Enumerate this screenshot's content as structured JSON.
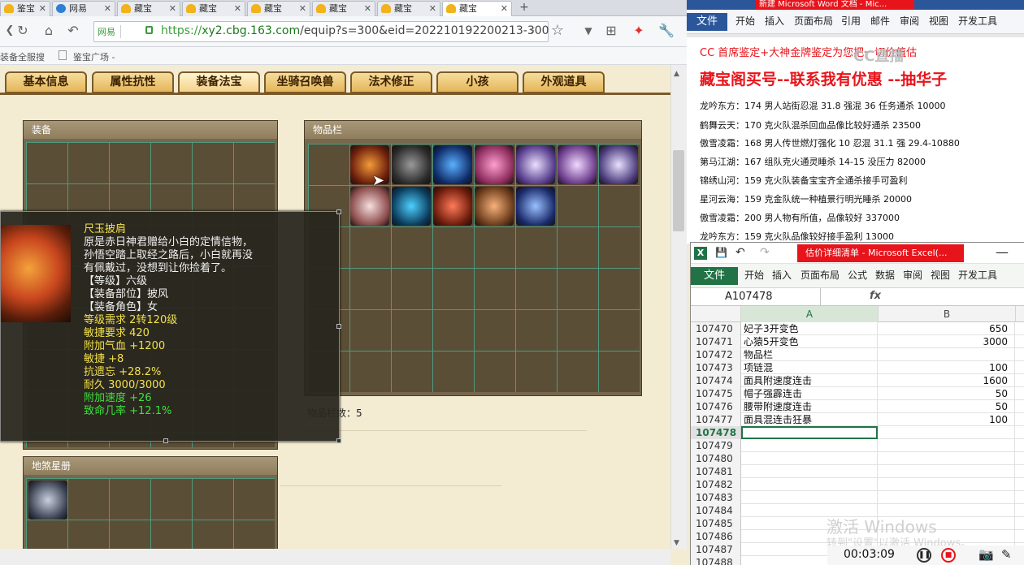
{
  "browser": {
    "tabs": [
      {
        "label": "鉴宝"
      },
      {
        "label": "网易"
      },
      {
        "label": "藏宝"
      },
      {
        "label": "藏宝"
      },
      {
        "label": "藏宝"
      },
      {
        "label": "藏宝"
      },
      {
        "label": "藏宝"
      },
      {
        "label": "藏宝"
      }
    ],
    "new_tab": "+",
    "security_label": "网易",
    "url_scheme": "https://",
    "url_host": "xy2.cbg.163.com",
    "url_path": "/equip?s=300&eid=202210192200213-300",
    "bookmarks": [
      "装备全服搜",
      "鉴宝广场 -"
    ]
  },
  "game": {
    "tabs": [
      "基本信息",
      "属性抗性",
      "装备法宝",
      "坐骑召唤兽",
      "法术修正",
      "小孩",
      "外观道具"
    ],
    "equip_panel_title": "装备",
    "inventory_panel_title": "物品栏",
    "star_panel_title": "地煞星册",
    "item_count_label": "物品栏数：5",
    "tooltip": {
      "name": "尺玉披肩",
      "desc": [
        "原是赤日神君赠给小白的定情信物，",
        "孙悟空踏上取经之路后，小白就再没",
        "有佩戴过，没想到让你捡着了。"
      ],
      "attrs": [
        "【等级】六级",
        "【装备部位】披风",
        "【装备角色】女"
      ],
      "stats": [
        "等级需求  2转120级",
        "敏捷要求  420",
        "附加气血  +1200",
        "敏捷  +8",
        "抗遗忘  +28.2%",
        "耐久  3000/3000"
      ],
      "green_stats": [
        "附加速度  +26",
        "致命几率  +12.1%"
      ]
    }
  },
  "word": {
    "title": "新建 Microsoft Word 文档 - Mic...",
    "file": "文件",
    "ribbon": [
      "开始",
      "插入",
      "页面布局",
      "引用",
      "邮件",
      "审阅",
      "视图",
      "开发工具"
    ],
    "line_cc": "CC 首席鉴定+大神金牌鉴定为您把一切价值估",
    "headline": "藏宝阁买号--联系我有优惠 --抽华子",
    "watermark": "CC直播",
    "lines": [
      "龙吟东方：174 男人站街忍混 31.8 强混 36 任务通杀 10000",
      "鹤舞云天：170 克火队混杀回血品像比较好通杀 23500",
      "傲雪凌霜：168 男人传世燃灯强化 10 忍混 31.1 强 29.4-10880",
      "第马江湖：167 组队克火通灵睡杀 14-15 没压力 82000",
      "锦绣山河：159 克火队装备宝宝齐全通杀接手可盈利",
      "星河云海：159 克金队统一种植景行明光睡杀 20000",
      "傲雪凌霜：200 男人物有所值，品像较好 337000",
      "龙吟东方：159 克火队品像较好接手盈利 13000"
    ]
  },
  "excel": {
    "title": "估价详细清单 - Microsoft Excel(...",
    "file": "文件",
    "ribbon": [
      "开始",
      "插入",
      "页面布局",
      "公式",
      "数据",
      "审阅",
      "视图",
      "开发工具"
    ],
    "name_box": "A107478",
    "fx": "fx",
    "columns": [
      "A",
      "B"
    ],
    "rows": [
      {
        "n": "107470",
        "a": "妃子3开变色",
        "b": "650"
      },
      {
        "n": "107471",
        "a": "心猿5开变色",
        "b": "3000"
      },
      {
        "n": "107472",
        "a": "物品栏",
        "b": ""
      },
      {
        "n": "107473",
        "a": "项链混",
        "b": "100"
      },
      {
        "n": "107474",
        "a": "面具附速度连击",
        "b": "1600"
      },
      {
        "n": "107475",
        "a": "帽子强霹连击",
        "b": "50"
      },
      {
        "n": "107476",
        "a": "腰带附速度连击",
        "b": "50"
      },
      {
        "n": "107477",
        "a": "面具混连击狂暴",
        "b": "100"
      },
      {
        "n": "107478",
        "a": "",
        "b": ""
      },
      {
        "n": "107479",
        "a": "",
        "b": ""
      },
      {
        "n": "107480",
        "a": "",
        "b": ""
      },
      {
        "n": "107481",
        "a": "",
        "b": ""
      },
      {
        "n": "107482",
        "a": "",
        "b": ""
      },
      {
        "n": "107483",
        "a": "",
        "b": ""
      },
      {
        "n": "107484",
        "a": "",
        "b": ""
      },
      {
        "n": "107485",
        "a": "",
        "b": ""
      },
      {
        "n": "107486",
        "a": "",
        "b": ""
      },
      {
        "n": "107487",
        "a": "",
        "b": ""
      },
      {
        "n": "107488",
        "a": "",
        "b": ""
      }
    ]
  },
  "overlay": {
    "activate_windows": "激活 Windows",
    "activate_hint": "转到\"设置\"以激活 Windows。",
    "rec_time": "00:03:09"
  }
}
